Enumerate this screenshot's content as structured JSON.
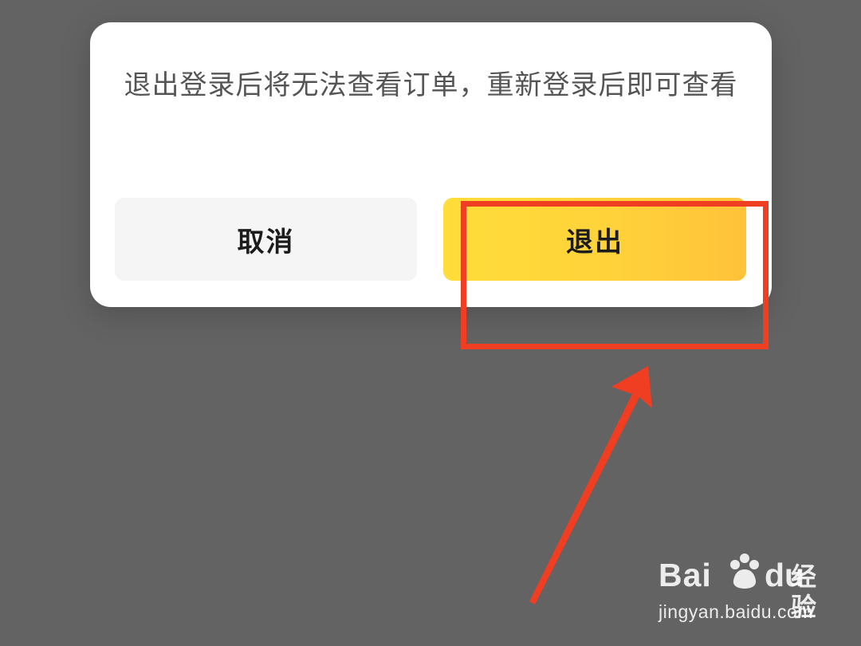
{
  "dialog": {
    "message": "退出登录后将无法查看订单，重新登录后即可查看",
    "cancel_label": "取消",
    "exit_label": "退出"
  },
  "annotation": {
    "highlight_color": "#f03e22",
    "arrow_color": "#f03e22",
    "icons": [
      "red-highlight-box",
      "red-arrow"
    ]
  },
  "watermark": {
    "brand_prefix": "Bai",
    "brand_suffix": "du",
    "brand_cn": "经验",
    "url": "jingyan.baidu.com",
    "icon": "baidu-paw-icon"
  },
  "colors": {
    "overlay": "#636363",
    "dialog_bg": "#ffffff",
    "exit_button": "#ffd23a",
    "cancel_button": "#f5f5f5"
  }
}
